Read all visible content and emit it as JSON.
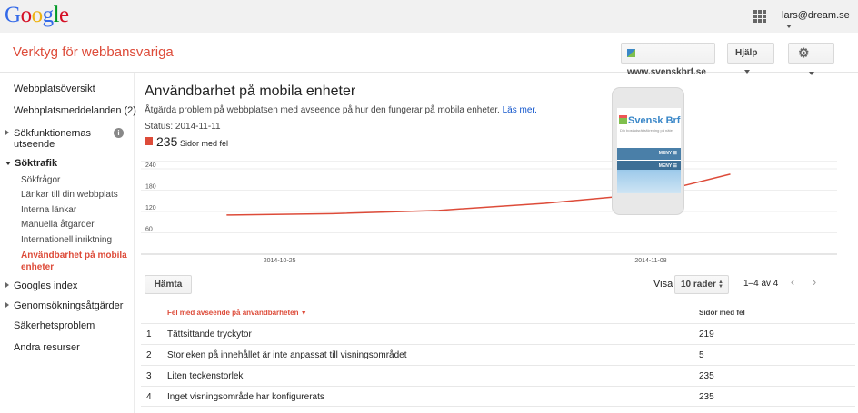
{
  "logo": {
    "letters": [
      {
        "ch": "G",
        "color": "#3369e8"
      },
      {
        "ch": "o",
        "color": "#d50f25"
      },
      {
        "ch": "o",
        "color": "#eeb211"
      },
      {
        "ch": "g",
        "color": "#3369e8"
      },
      {
        "ch": "l",
        "color": "#009925"
      },
      {
        "ch": "e",
        "color": "#d50f25"
      }
    ]
  },
  "account": {
    "email": "lars@dream.se"
  },
  "app": {
    "title": "Verktyg för webbansvariga"
  },
  "toolbar": {
    "site": "www.svenskbrf.se",
    "help": "Hjälp"
  },
  "sidebar": {
    "items": [
      {
        "label": "Webbplatsöversikt"
      },
      {
        "label": "Webbplatsmeddelanden (2)"
      },
      {
        "label_line1": "Sökfunktionernas",
        "label_line2": "utseende"
      },
      {
        "label": "Söktrafik"
      },
      {
        "label": "Sökfrågor"
      },
      {
        "label": "Länkar till din webbplats"
      },
      {
        "label": "Interna länkar"
      },
      {
        "label": "Manuella åtgärder"
      },
      {
        "label": "Internationell inriktning"
      },
      {
        "label_line1": "Användbarhet på mobila",
        "label_line2": "enheter"
      },
      {
        "label": "Googles index"
      },
      {
        "label": "Genomsökningsåtgärder"
      },
      {
        "label": "Säkerhetsproblem"
      },
      {
        "label": "Andra resurser"
      }
    ]
  },
  "main": {
    "title": "Användbarhet på mobila enheter",
    "description": "Åtgärda problem på webbplatsen med avseende på hur den fungerar på mobila enheter.",
    "learn_more": "Läs mer.",
    "status": "Status: 2014-11-11",
    "count": "235",
    "count_label": "Sidor med fel"
  },
  "chart_data": {
    "type": "line",
    "series": [
      {
        "name": "Sidor med fel",
        "color": "#dd4b39",
        "x": [
          "2014-10-23",
          "2014-10-27",
          "2014-10-31",
          "2014-11-04",
          "2014-11-08",
          "2014-11-11"
        ],
        "values": [
          110,
          114,
          123,
          143,
          170,
          225
        ]
      }
    ],
    "yticks": [
      "240",
      "180",
      "120",
      "60"
    ],
    "xticks": [
      "2014-10-25",
      "2014-11-08"
    ],
    "ylim": [
      0,
      240
    ]
  },
  "phone": {
    "brand": "Svensk Brf",
    "tagline": "Din bostadsrättsförening på nätet",
    "menu": "MENY ☰"
  },
  "controls": {
    "fetch": "Hämta",
    "show": "Visa",
    "rows": "10 rader",
    "range": "1–4 av 4"
  },
  "table": {
    "col_issue": "Fel med avseende på användbarheten",
    "col_pages": "Sidor med fel",
    "rows": [
      {
        "idx": "1",
        "issue": "Tättsittande tryckytor",
        "pages": "219"
      },
      {
        "idx": "2",
        "issue": "Storleken på innehållet är inte anpassat till visningsområdet",
        "pages": "5"
      },
      {
        "idx": "3",
        "issue": "Liten teckenstorlek",
        "pages": "235"
      },
      {
        "idx": "4",
        "issue": "Inget visningsområde har konfigurerats",
        "pages": "235"
      }
    ]
  },
  "colors": {
    "accent": "#dd4b39",
    "link": "#1155cc"
  }
}
